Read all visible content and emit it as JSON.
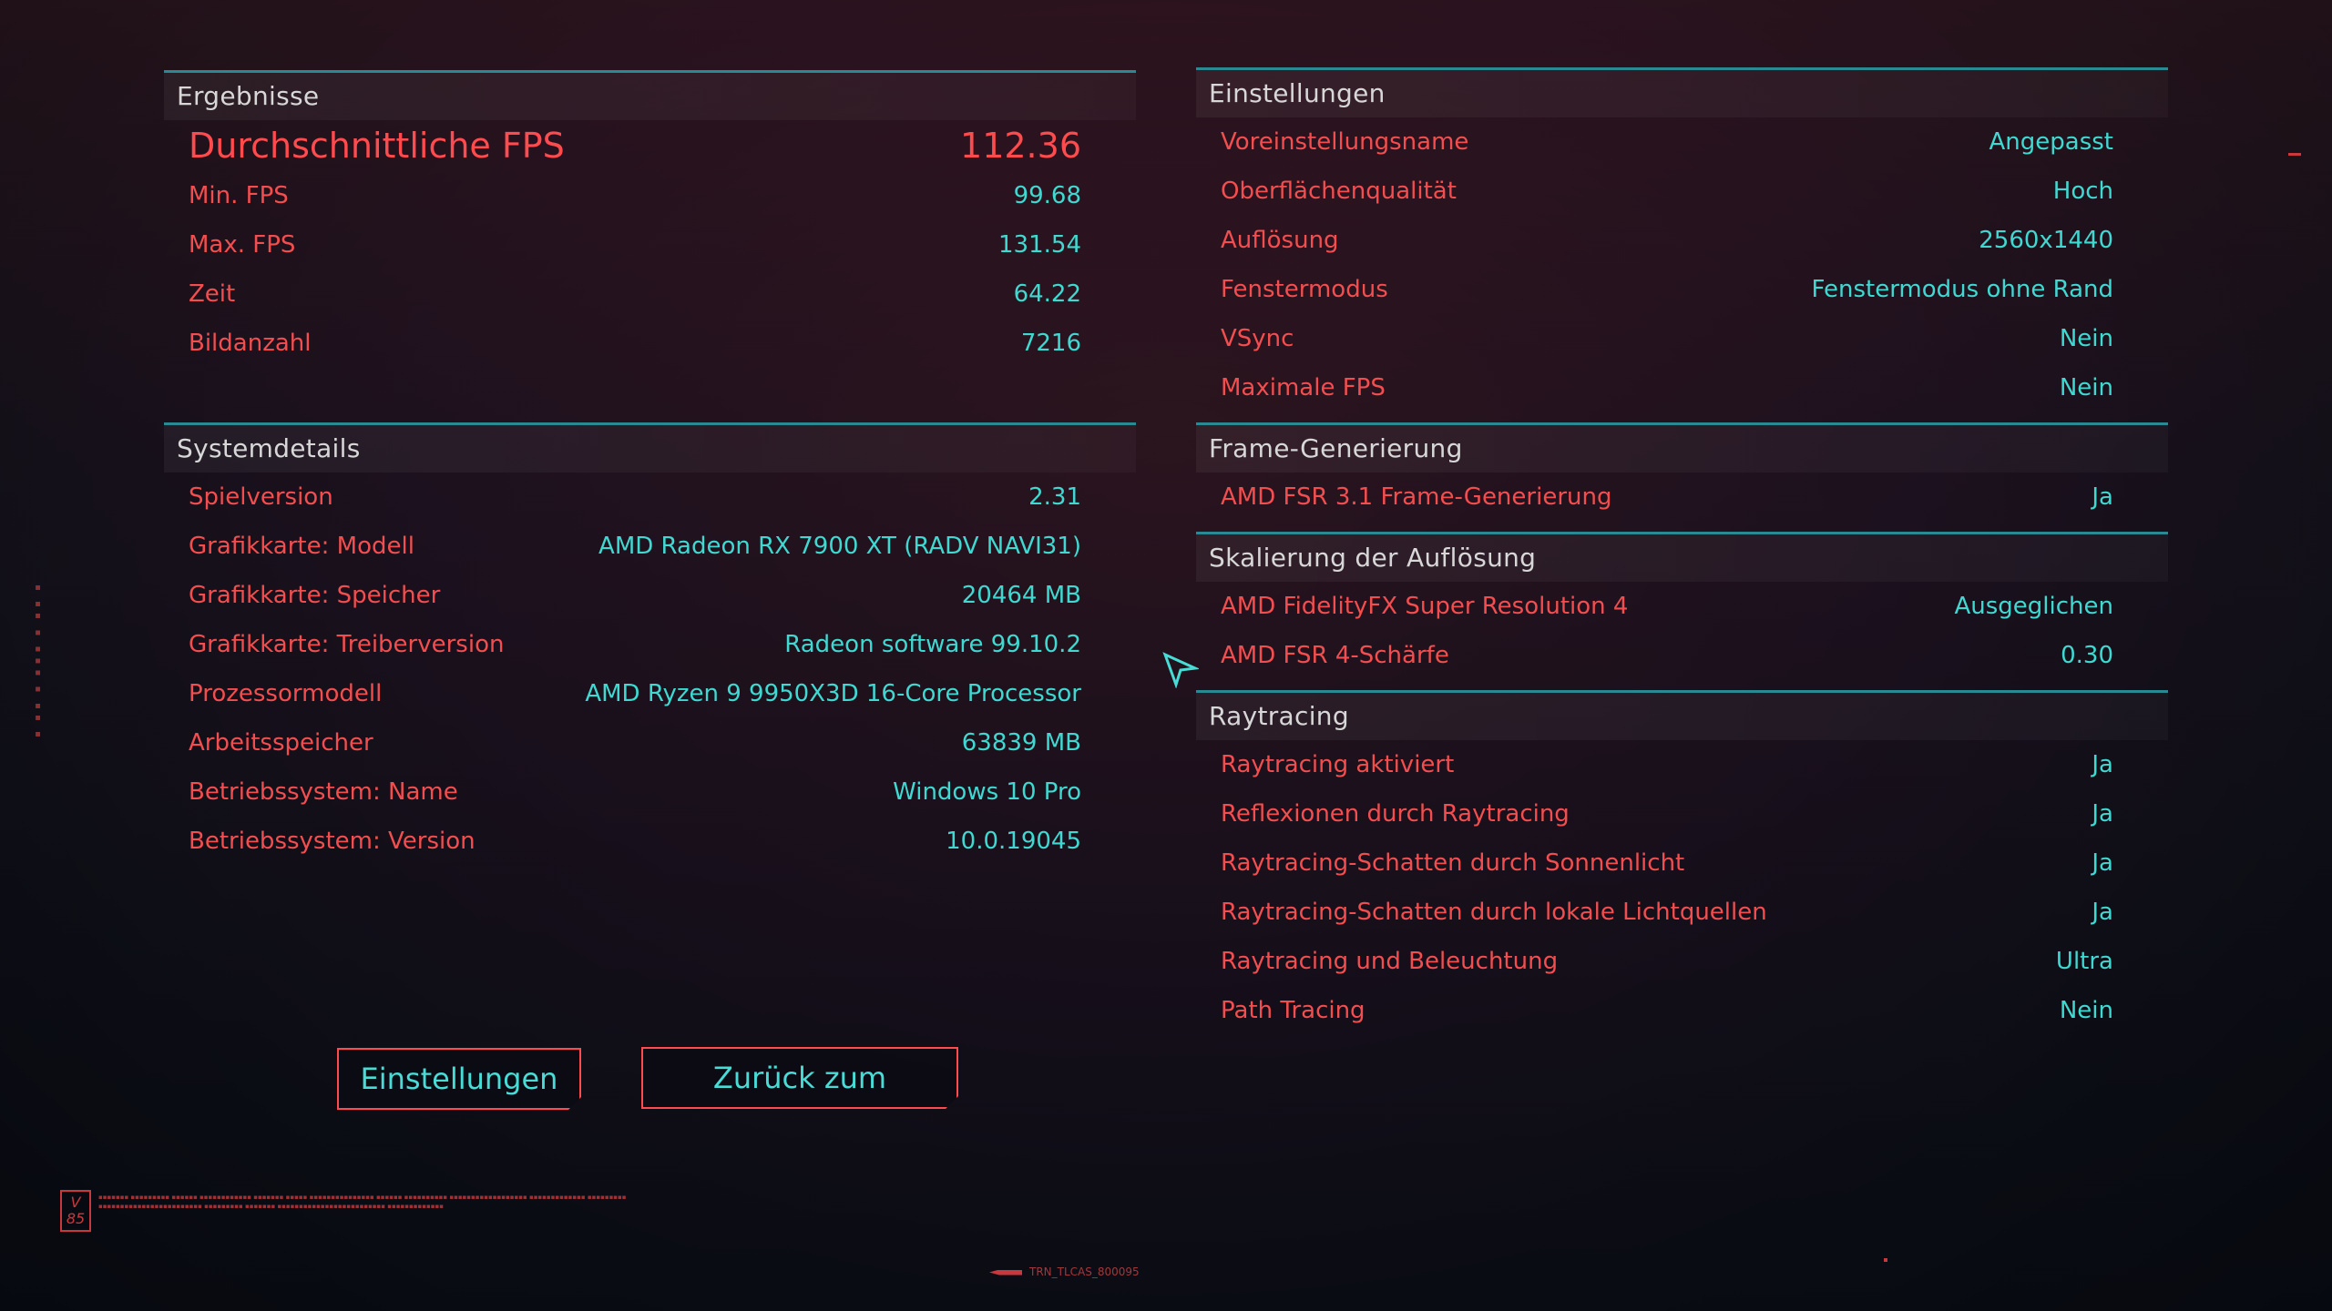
{
  "ergebnisse": {
    "title": "Ergebnisse",
    "avg_fps": {
      "label": "Durchschnittliche FPS",
      "value": "112.36"
    },
    "rows": [
      {
        "label": "Min. FPS",
        "value": "99.68"
      },
      {
        "label": "Max. FPS",
        "value": "131.54"
      },
      {
        "label": "Zeit",
        "value": "64.22"
      },
      {
        "label": "Bildanzahl",
        "value": "7216"
      }
    ]
  },
  "systemdetails": {
    "title": "Systemdetails",
    "rows": [
      {
        "label": "Spielversion",
        "value": "2.31"
      },
      {
        "label": "Grafikkarte: Modell",
        "value": "AMD Radeon RX 7900 XT (RADV NAVI31)"
      },
      {
        "label": "Grafikkarte: Speicher",
        "value": "20464 MB"
      },
      {
        "label": "Grafikkarte: Treiberversion",
        "value": "Radeon software 99.10.2"
      },
      {
        "label": "Prozessormodell",
        "value": "AMD Ryzen 9 9950X3D 16-Core Processor"
      },
      {
        "label": "Arbeitsspeicher",
        "value": "63839 MB"
      },
      {
        "label": "Betriebssystem: Name",
        "value": "Windows 10 Pro"
      },
      {
        "label": "Betriebssystem: Version",
        "value": "10.0.19045"
      }
    ]
  },
  "einstellungen": {
    "title": "Einstellungen",
    "rows": [
      {
        "label": "Voreinstellungsname",
        "value": "Angepasst"
      },
      {
        "label": "Oberflächenqualität",
        "value": "Hoch"
      },
      {
        "label": "Auflösung",
        "value": "2560x1440"
      },
      {
        "label": "Fenstermodus",
        "value": "Fenstermodus ohne Rand"
      },
      {
        "label": "VSync",
        "value": "Nein"
      },
      {
        "label": "Maximale FPS",
        "value": "Nein"
      }
    ]
  },
  "framegen": {
    "title": "Frame-Generierung",
    "rows": [
      {
        "label": "AMD FSR 3.1 Frame-Generierung",
        "value": "Ja"
      }
    ]
  },
  "skalierung": {
    "title": "Skalierung der Auflösung",
    "rows": [
      {
        "label": "AMD FidelityFX Super Resolution 4",
        "value": "Ausgeglichen"
      },
      {
        "label": "AMD FSR 4-Schärfe",
        "value": "0.30"
      }
    ]
  },
  "raytracing": {
    "title": "Raytracing",
    "rows": [
      {
        "label": "Raytracing aktiviert",
        "value": "Ja"
      },
      {
        "label": "Reflexionen durch Raytracing",
        "value": "Ja"
      },
      {
        "label": "Raytracing-Schatten durch Sonnenlicht",
        "value": "Ja"
      },
      {
        "label": "Raytracing-Schatten durch lokale Lichtquellen",
        "value": "Ja"
      },
      {
        "label": "Raytracing und Beleuchtung",
        "value": "Ultra"
      },
      {
        "label": "Path Tracing",
        "value": "Nein"
      }
    ]
  },
  "buttons": {
    "settings": "Einstellungen",
    "back": "Zurück zum Hauptmenü"
  },
  "footer": {
    "version_badge": "V 85",
    "tag": "TRN_TLCAS_800095"
  },
  "colors": {
    "label_red": "#f24e4f",
    "value_cyan": "#3fd9d2",
    "divider_teal": "#2a8a93"
  }
}
